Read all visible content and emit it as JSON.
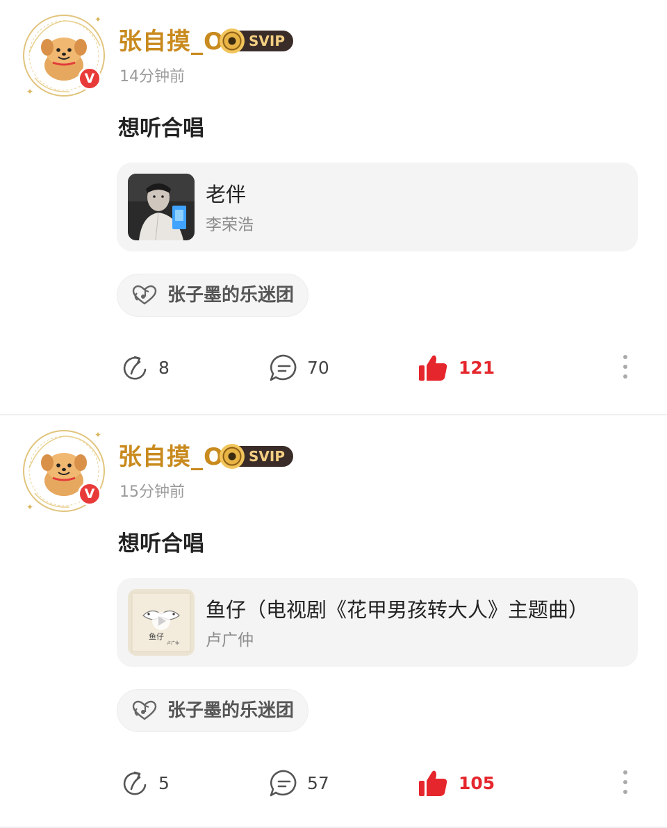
{
  "posts": [
    {
      "username": "张自摸_O",
      "vip_label": "SVIP",
      "verified_label": "V",
      "timestamp": "14分钟前",
      "text": "想听合唱",
      "song": {
        "title": "老伴",
        "artist": "李荣浩"
      },
      "fan_group": "张子墨的乐迷团",
      "share_count": "8",
      "comment_count": "70",
      "like_count": "121"
    },
    {
      "username": "张自摸_O",
      "vip_label": "SVIP",
      "verified_label": "V",
      "timestamp": "15分钟前",
      "text": "想听合唱",
      "song": {
        "title": "鱼仔（电视剧《花甲男孩转大人》主题曲）",
        "artist": "卢广仲"
      },
      "fan_group": "张子墨的乐迷团",
      "share_count": "5",
      "comment_count": "57",
      "like_count": "105"
    }
  ],
  "colors": {
    "username": "#c98a1e",
    "like_active": "#e5262c",
    "verified_badge": "#e93a3a",
    "card_background": "#f4f4f4"
  },
  "icons": {
    "share": "share-icon",
    "comment": "comment-icon",
    "like": "thumbs-up-icon",
    "more": "more-vertical-icon",
    "fan_group": "heart-music-icon"
  }
}
